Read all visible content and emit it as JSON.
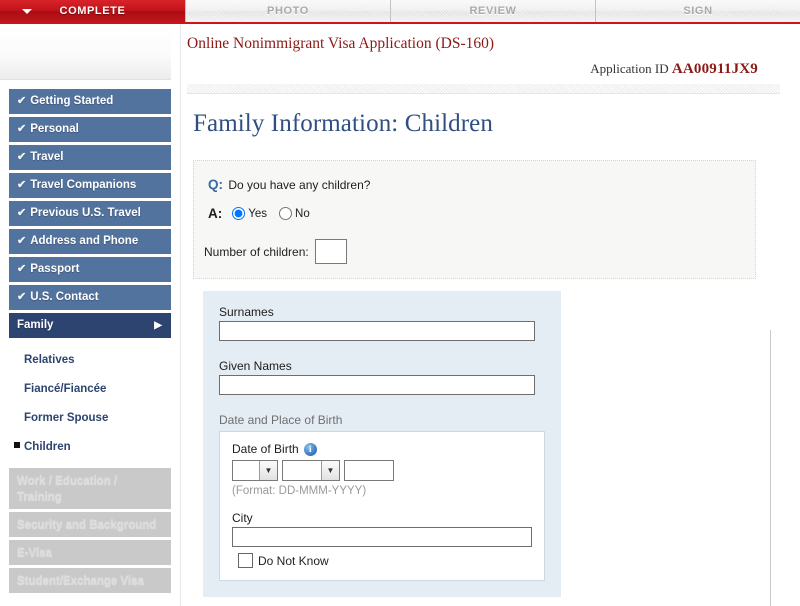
{
  "tabs": [
    {
      "label": "COMPLETE",
      "state": "active",
      "caret": "caret-down-icon"
    },
    {
      "label": "PHOTO",
      "state": "disabled"
    },
    {
      "label": "REVIEW",
      "state": "disabled"
    },
    {
      "label": "SIGN",
      "state": "disabled"
    }
  ],
  "header": {
    "app_title": "Online Nonimmigrant Visa Application (DS-160)",
    "application_id_label": "Application ID",
    "application_id_value": "AA00911JX9"
  },
  "page": {
    "title": "Family Information: Children"
  },
  "sidebar": {
    "items": [
      {
        "label": "Getting Started",
        "check": "✔",
        "state": "complete"
      },
      {
        "label": "Personal",
        "check": "✔",
        "state": "complete"
      },
      {
        "label": "Travel",
        "check": "✔",
        "state": "complete"
      },
      {
        "label": "Travel Companions",
        "check": "✔",
        "state": "complete"
      },
      {
        "label": "Previous U.S. Travel",
        "check": "✔",
        "state": "complete"
      },
      {
        "label": "Address and Phone",
        "check": "✔",
        "state": "complete"
      },
      {
        "label": "Passport",
        "check": "✔",
        "state": "complete"
      },
      {
        "label": "U.S. Contact",
        "check": "✔",
        "state": "complete"
      },
      {
        "label": "Family",
        "state": "current",
        "arrow": "▶"
      }
    ],
    "subitems": [
      {
        "label": "Relatives",
        "selected": false
      },
      {
        "label": "Fiancé/Fiancée",
        "selected": false
      },
      {
        "label": "Former Spouse",
        "selected": false
      },
      {
        "label": "Children",
        "selected": true
      }
    ],
    "disabled_items": [
      {
        "label": "Work / Education / Training"
      },
      {
        "label": "Security and Background"
      },
      {
        "label": "E-Visa"
      },
      {
        "label": "Student/Exchange Visa"
      }
    ]
  },
  "form": {
    "q_marker": "Q:",
    "a_marker": "A:",
    "question": "Do you have any children?",
    "options": [
      {
        "label": "Yes",
        "checked": true
      },
      {
        "label": "No",
        "checked": false
      }
    ],
    "number_of_children_label": "Number of children:",
    "number_of_children_value": "",
    "surnames_label": "Surnames",
    "surnames_value": "",
    "given_names_label": "Given Names",
    "given_names_value": "",
    "dob_section_label": "Date and Place of Birth",
    "dob_label": "Date of Birth",
    "dob_info_icon": "info-icon",
    "dob_day_value": "",
    "dob_month_value": "",
    "dob_year_value": "",
    "dob_format_hint": "(Format: DD-MMM-YYYY)",
    "city_label": "City",
    "city_value": "",
    "do_not_know_label": "Do Not Know",
    "do_not_know_checked": false
  },
  "colors": {
    "accent_red": "#c2131a",
    "title_red": "#8b1a16",
    "nav_blue": "#53739f",
    "nav_current_blue": "#2d4470",
    "heading_blue": "#2f4f82",
    "form_block_blue": "#e4ecf4"
  }
}
